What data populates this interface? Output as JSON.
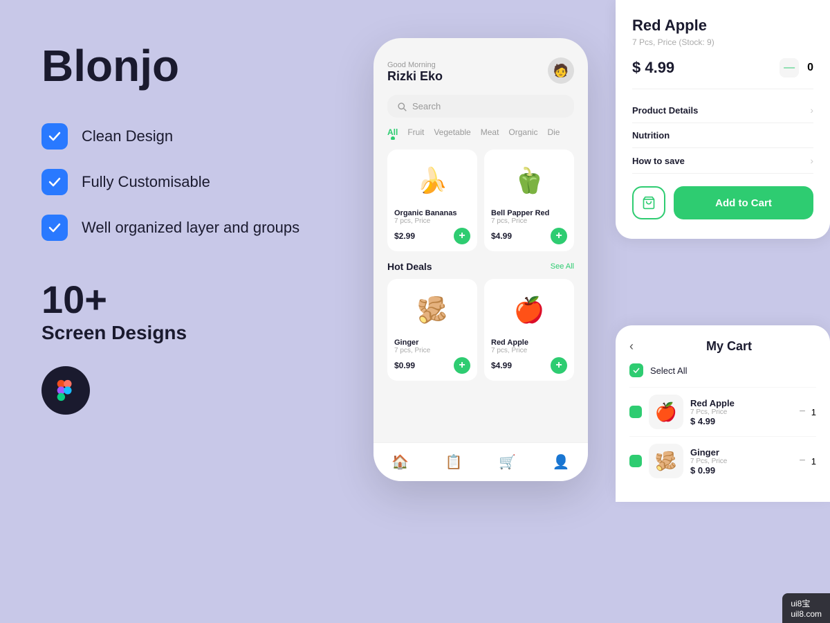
{
  "brand": {
    "title": "Blonjo"
  },
  "features": [
    {
      "label": "Clean Design"
    },
    {
      "label": "Fully Customisable"
    },
    {
      "label": "Well organized layer and groups"
    }
  ],
  "count": {
    "number": "10+",
    "label": "Screen Designs"
  },
  "phone": {
    "greeting": "Good Morning",
    "user": "Rizki Eko",
    "search_placeholder": "Search",
    "categories": [
      "All",
      "Fruit",
      "Vegetable",
      "Meat",
      "Organic",
      "Die"
    ],
    "active_category": "All",
    "products": [
      {
        "name": "Organic Bananas",
        "sub": "7 pcs, Price",
        "price": "$2.99",
        "emoji": "🍌"
      },
      {
        "name": "Bell Papper Red",
        "sub": "7 pcs, Price",
        "price": "$4.99",
        "emoji": "🫑"
      }
    ],
    "hot_deals_title": "Hot Deals",
    "see_all": "See All",
    "hot_products": [
      {
        "name": "Ginger",
        "sub": "7 pcs, Price",
        "price": "$0.99",
        "emoji": "🫚"
      },
      {
        "name": "Red Apple",
        "sub": "7 pcs, Price",
        "price": "$4.99",
        "emoji": "🍎"
      }
    ]
  },
  "product_detail": {
    "name": "Red Apple",
    "sub": "7 Pcs, Price  (Stock: 9)",
    "price": "$ 4.99",
    "qty": "0",
    "rows": [
      {
        "label": "Product Details"
      },
      {
        "label": "Nutrition"
      },
      {
        "label": "How to save"
      }
    ],
    "add_to_cart_label": "Add to Cart"
  },
  "cart": {
    "title": "My Cart",
    "select_all": "Select All",
    "items": [
      {
        "name": "Red Apple",
        "sub": "7 Pcs, Price",
        "price": "$ 4.99",
        "qty": "1",
        "emoji": "🍎"
      },
      {
        "name": "Ginger",
        "sub": "7 Pcs, Price",
        "price": "$ 0.99",
        "qty": "1",
        "emoji": "🫚"
      }
    ]
  },
  "watermark": {
    "line1": "ui8宝",
    "line2": "uil8.com"
  }
}
